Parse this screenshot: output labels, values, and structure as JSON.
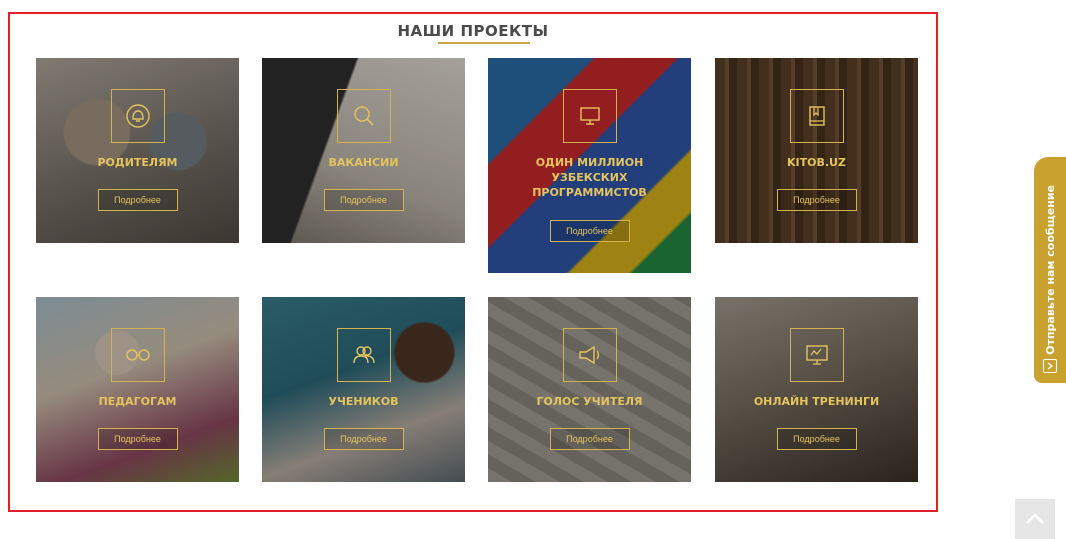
{
  "section": {
    "title": "НАШИ ПРОЕКТЫ"
  },
  "colors": {
    "accent": "#d4b24f",
    "frame": "#e3202a",
    "side_tab": "#c9a12f"
  },
  "cards": [
    {
      "label": "РОДИТЕЛЯМ",
      "button": "Подробнее",
      "icon": "bell-icon"
    },
    {
      "label": "ВАКАНСИИ",
      "button": "Подробнее",
      "icon": "magnifier-icon"
    },
    {
      "label": "ОДИН МИЛЛИОН УЗБЕКСКИХ ПРОГРАММИСТОВ",
      "button": "Подробнее",
      "icon": "monitor-icon"
    },
    {
      "label": "KITOB.UZ",
      "button": "Подробнее",
      "icon": "book-icon"
    },
    {
      "label": "ПЕДАГОГАМ",
      "button": "Подробнее",
      "icon": "glasses-icon"
    },
    {
      "label": "УЧЕНИКОВ",
      "button": "Подробнее",
      "icon": "users-icon"
    },
    {
      "label": "ГОЛОС УЧИТЕЛЯ",
      "button": "Подробнее",
      "icon": "megaphone-icon"
    },
    {
      "label": "ОНЛАЙН ТРЕНИНГИ",
      "button": "Подробнее",
      "icon": "presentation-board-icon"
    }
  ],
  "side_tab": {
    "label": "Отправьте нам сообщение",
    "icon": "chevron-right-icon"
  },
  "scroll_top": {
    "icon": "chevron-up-icon"
  }
}
